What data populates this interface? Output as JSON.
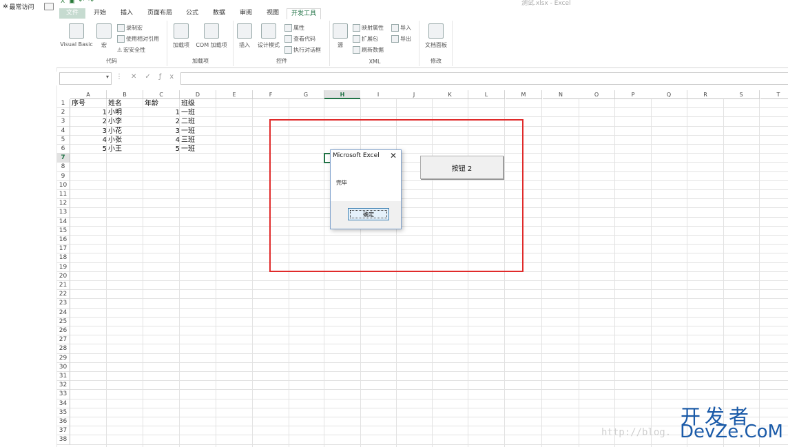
{
  "quick_access": {
    "label": "最常访问"
  },
  "window": {
    "title": "测试.xlsx - Excel"
  },
  "tabs": [
    {
      "label": "文件"
    },
    {
      "label": "开始"
    },
    {
      "label": "插入"
    },
    {
      "label": "页面布局"
    },
    {
      "label": "公式"
    },
    {
      "label": "数据"
    },
    {
      "label": "审阅"
    },
    {
      "label": "视图"
    },
    {
      "label": "开发工具"
    }
  ],
  "ribbon": {
    "code": {
      "label": "代码",
      "visual_basic": "Visual Basic",
      "macro": "宏",
      "record_macro": "录制宏",
      "relative_ref": "使用相对引用",
      "macro_security": "宏安全性"
    },
    "addins": {
      "label": "加载项",
      "addins": "加载项",
      "com_addins": "COM 加载项"
    },
    "controls": {
      "label": "控件",
      "insert": "插入",
      "design_mode": "设计模式",
      "properties": "属性",
      "view_code": "查看代码",
      "run_dialog": "执行对话框"
    },
    "xml": {
      "label": "XML",
      "source": "源",
      "map_properties": "映射属性",
      "expansion_packs": "扩展包",
      "refresh_data": "刷新数据",
      "import": "导入",
      "export": "导出"
    },
    "modify": {
      "label": "修改",
      "document_panel": "文档面板"
    }
  },
  "formula_bar": {
    "name_box": "",
    "content": ""
  },
  "columns": [
    "A",
    "B",
    "C",
    "D",
    "E",
    "F",
    "G",
    "H",
    "I",
    "J",
    "K",
    "L",
    "M",
    "N",
    "O",
    "P",
    "Q",
    "R",
    "S",
    "T"
  ],
  "selected_column": "H",
  "selected_row": 7,
  "row_count": 38,
  "headers": {
    "a": "序号",
    "b": "姓名",
    "c": "年龄",
    "d": "班级"
  },
  "rows": [
    {
      "id": "1",
      "name": "小明",
      "cls_num": "1",
      "cls": "一班"
    },
    {
      "id": "2",
      "name": "小李",
      "cls_num": "2",
      "cls": "二班"
    },
    {
      "id": "3",
      "name": "小花",
      "cls_num": "3",
      "cls": "一班"
    },
    {
      "id": "4",
      "name": "小张",
      "cls_num": "4",
      "cls": "三班"
    },
    {
      "id": "5",
      "name": "小王",
      "cls_num": "5",
      "cls": "一班"
    }
  ],
  "sheet_button": {
    "label": "按钮 2"
  },
  "message_box": {
    "title": "Microsoft Excel",
    "close": "✕",
    "text": "完毕",
    "ok_label": "确定"
  },
  "watermark": {
    "cn": "开发者",
    "en": "DevZe.CoM",
    "url": "http://blog."
  },
  "colors": {
    "accent": "#217346",
    "annotation": "#e02a2a",
    "watermark": "#1a5aa8"
  }
}
